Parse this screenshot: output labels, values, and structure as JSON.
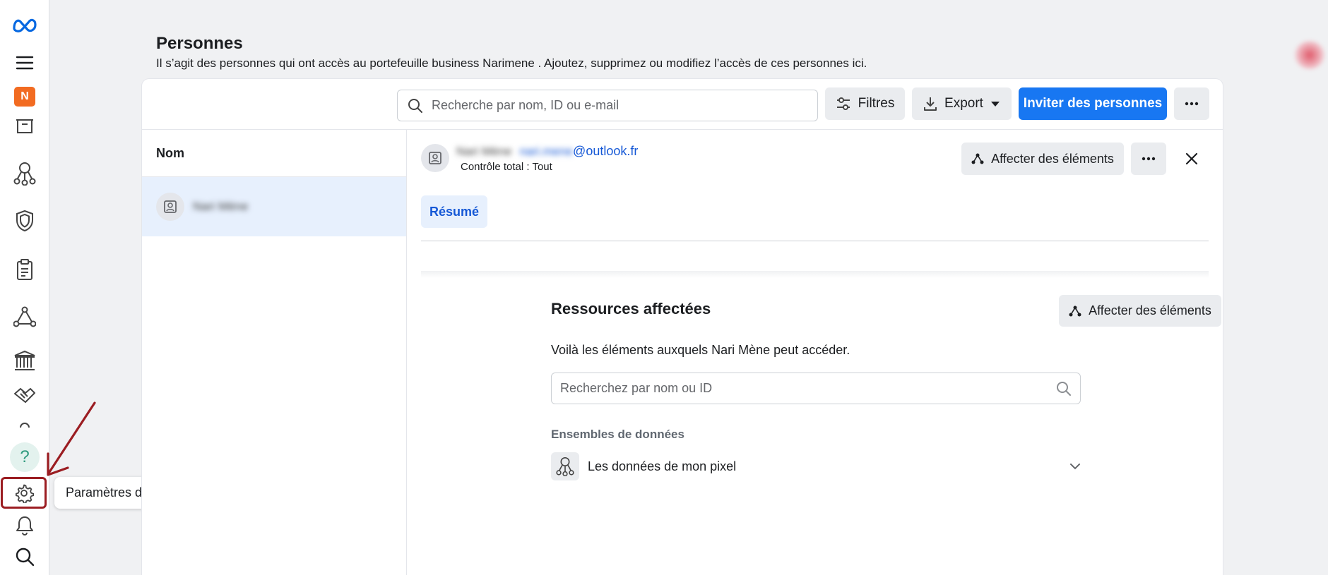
{
  "rail": {
    "org_initial": "N",
    "help_glyph": "?",
    "icons": [
      "meta-logo-icon",
      "menu-icon",
      "archive-icon",
      "people-network-icon",
      "shield-icon",
      "clipboard-icon",
      "triangle-nodes-icon",
      "bank-icon",
      "handshake-icon",
      "help-icon",
      "settings-icon",
      "bell-icon",
      "search-icon"
    ]
  },
  "tooltip": {
    "text": "Paramètres de l’entreprise"
  },
  "header": {
    "title": "Personnes",
    "description": "Il s’agit des personnes qui ont accès au portefeuille business Narimene . Ajoutez, supprimez ou modifiez l’accès de ces personnes ici."
  },
  "toolbar": {
    "search_placeholder": "Recherche par nom, ID ou e-mail",
    "filters_label": "Filtres",
    "export_label": "Export",
    "invite_label": "Inviter des personnes"
  },
  "list": {
    "column_header": "Nom",
    "rows": [
      {
        "name": "Nari Mène"
      }
    ]
  },
  "detail": {
    "name_blurred": "Nari Mène",
    "email_user_blurred": "nari.mene",
    "email_domain": "@outlook.fr",
    "role": "Contrôle total : Tout",
    "assign_label": "Affecter des éléments",
    "tab_summary": "Résumé"
  },
  "resources": {
    "title": "Ressources affectées",
    "assign_label": "Affecter des éléments",
    "description": "Voilà les éléments auxquels Nari Mène peut accéder.",
    "search_placeholder": "Recherchez par nom ou ID",
    "section_label": "Ensembles de données",
    "datasets": [
      {
        "name": "Les données de mon pixel"
      }
    ]
  },
  "colors": {
    "accent": "#1877f2",
    "highlight": "#9b1d22",
    "selected_row": "#e7f0fd"
  }
}
